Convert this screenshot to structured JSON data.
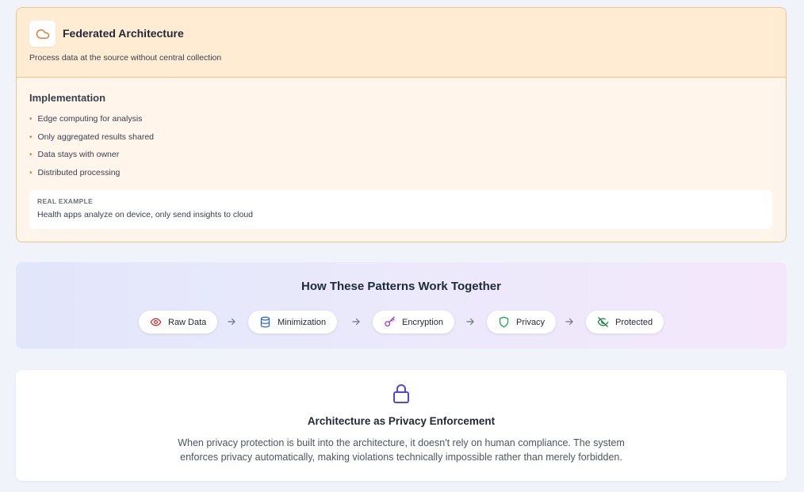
{
  "federated": {
    "title": "Federated Architecture",
    "subtitle": "Process data at the source without central collection",
    "icon": "cloud-icon",
    "implementation_title": "Implementation",
    "items": [
      "Edge computing for analysis",
      "Only aggregated results shared",
      "Data stays with owner",
      "Distributed processing"
    ],
    "example_label": "REAL EXAMPLE",
    "example_text": "Health apps analyze on device, only send insights to cloud",
    "accent_color": "#ea7a2c"
  },
  "flow": {
    "title": "How These Patterns Work Together",
    "steps": [
      {
        "label": "Raw Data",
        "icon": "eye-icon",
        "color": "#dc2626"
      },
      {
        "label": "Minimization",
        "icon": "database-icon",
        "color": "#2563eb"
      },
      {
        "label": "Encryption",
        "icon": "key-icon",
        "color": "#9333ea"
      },
      {
        "label": "Privacy",
        "icon": "shield-icon",
        "color": "#16a34a"
      },
      {
        "label": "Protected",
        "icon": "eye-off-icon",
        "color": "#15803d"
      }
    ]
  },
  "enforcement": {
    "icon": "lock-icon",
    "title": "Architecture as Privacy Enforcement",
    "description": "When privacy protection is built into the architecture, it doesn't rely on human compliance. The system enforces privacy automatically, making violations technically impossible rather than merely forbidden.",
    "accent_color": "#4f46e5"
  }
}
